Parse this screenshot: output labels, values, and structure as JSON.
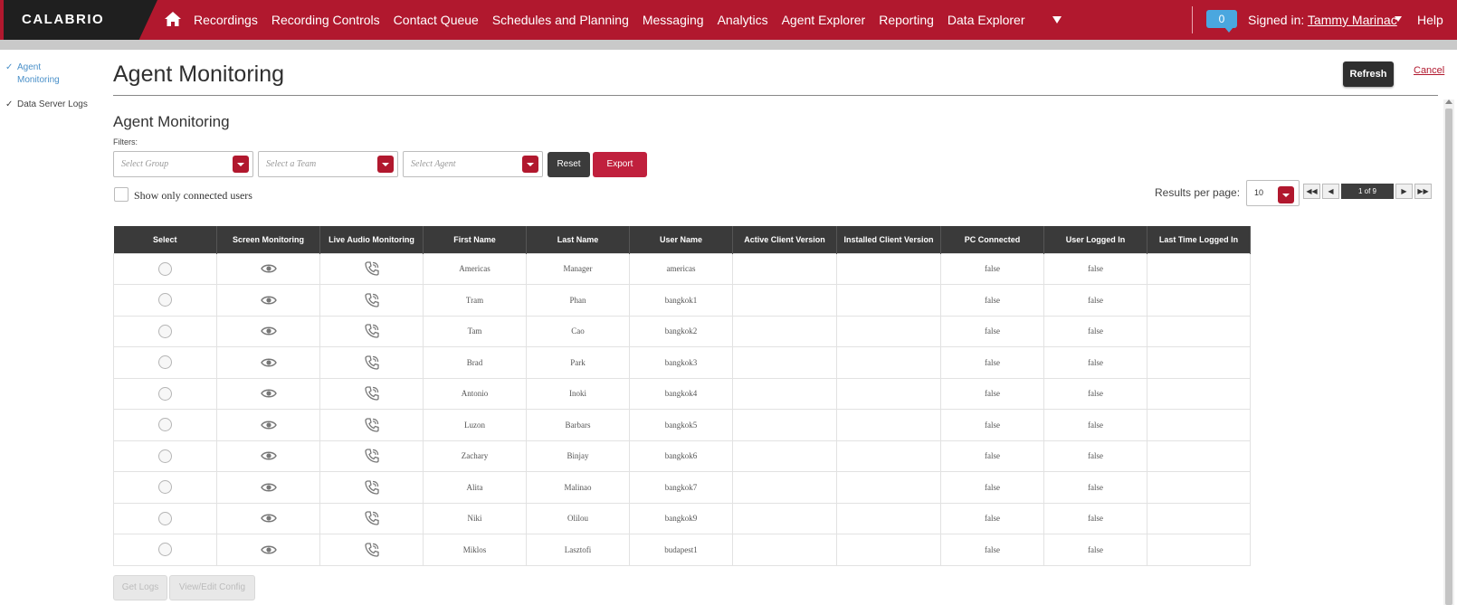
{
  "topbar": {
    "brand": "CALABRIO",
    "nav": [
      "Recordings",
      "Recording Controls",
      "Contact Queue",
      "Schedules and Planning",
      "Messaging",
      "Analytics",
      "Agent Explorer",
      "Reporting",
      "Data Explorer"
    ],
    "notification_count": "0",
    "signed_in_label": "Signed in:",
    "user_name": "Tammy Marinac",
    "help": "Help"
  },
  "sidebar": {
    "items": [
      {
        "label": "Agent Monitoring",
        "active": true
      },
      {
        "label": "Data Server Logs",
        "active": false
      }
    ]
  },
  "header": {
    "title": "Agent Monitoring",
    "refresh": "Refresh",
    "cancel": "Cancel"
  },
  "section": {
    "title": "Agent Monitoring",
    "filters_label": "Filters:",
    "group_placeholder": "Select Group",
    "team_placeholder": "Select a Team",
    "agent_placeholder": "Select Agent",
    "reset": "Reset",
    "export": "Export",
    "connected_only": "Show only connected users",
    "results_per_page_label": "Results per page:",
    "results_per_page": "10",
    "page_info": "1 of 9"
  },
  "table": {
    "columns": [
      "Select",
      "Screen Monitoring",
      "Live Audio Monitoring",
      "First Name",
      "Last Name",
      "User Name",
      "Active Client Version",
      "Installed Client Version",
      "PC Connected",
      "User Logged In",
      "Last Time Logged In"
    ],
    "rows": [
      {
        "first": "Americas",
        "last": "Manager",
        "user": "americas",
        "pc": "false",
        "logged": "false"
      },
      {
        "first": "Tram",
        "last": "Phan",
        "user": "bangkok1",
        "pc": "false",
        "logged": "false"
      },
      {
        "first": "Tam",
        "last": "Cao",
        "user": "bangkok2",
        "pc": "false",
        "logged": "false"
      },
      {
        "first": "Brad",
        "last": "Park",
        "user": "bangkok3",
        "pc": "false",
        "logged": "false"
      },
      {
        "first": "Antonio",
        "last": "Inoki",
        "user": "bangkok4",
        "pc": "false",
        "logged": "false"
      },
      {
        "first": "Luzon",
        "last": "Barbars",
        "user": "bangkok5",
        "pc": "false",
        "logged": "false"
      },
      {
        "first": "Zachary",
        "last": "Binjay",
        "user": "bangkok6",
        "pc": "false",
        "logged": "false"
      },
      {
        "first": "Alita",
        "last": "Malinao",
        "user": "bangkok7",
        "pc": "false",
        "logged": "false"
      },
      {
        "first": "Niki",
        "last": "Olilou",
        "user": "bangkok9",
        "pc": "false",
        "logged": "false"
      },
      {
        "first": "Miklos",
        "last": "Lasztofi",
        "user": "budapest1",
        "pc": "false",
        "logged": "false"
      }
    ]
  },
  "footer": {
    "get_logs": "Get Logs",
    "view_edit_config": "View/Edit Config"
  },
  "colors": {
    "brand_red": "#b1182e",
    "accent_blue": "#4aa7df",
    "header_dark": "#3a3a3a"
  }
}
